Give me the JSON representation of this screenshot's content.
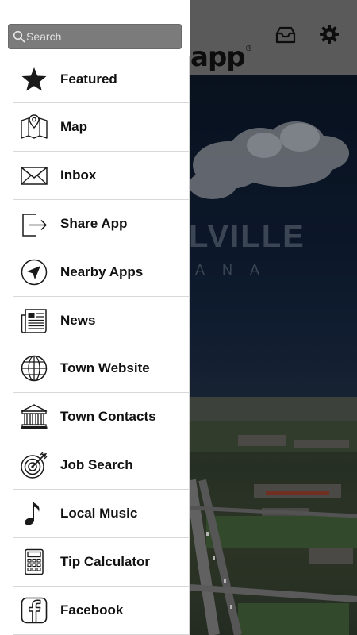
{
  "search": {
    "placeholder": "Search",
    "value": ""
  },
  "menu": {
    "items": [
      {
        "label": "Featured",
        "icon": "star-icon"
      },
      {
        "label": "Map",
        "icon": "map-icon"
      },
      {
        "label": "Inbox",
        "icon": "envelope-icon"
      },
      {
        "label": "Share App",
        "icon": "share-icon"
      },
      {
        "label": "Nearby Apps",
        "icon": "compass-arrow-icon"
      },
      {
        "label": "News",
        "icon": "newspaper-icon"
      },
      {
        "label": "Town Website",
        "icon": "globe-icon"
      },
      {
        "label": "Town Contacts",
        "icon": "building-icon"
      },
      {
        "label": "Job Search",
        "icon": "target-icon"
      },
      {
        "label": "Local Music",
        "icon": "music-note-icon"
      },
      {
        "label": "Tip Calculator",
        "icon": "calculator-icon"
      },
      {
        "label": "Facebook",
        "icon": "facebook-icon"
      }
    ]
  },
  "background": {
    "logo_text": "app",
    "logo_mark": "®",
    "town_name": "LVILLE",
    "state_name": "ANA"
  },
  "colors": {
    "drawer_bg": "#ffffff",
    "search_bg": "#7b7b7b",
    "header_bg": "#6e6e6e",
    "sky": "#0f1d33"
  }
}
